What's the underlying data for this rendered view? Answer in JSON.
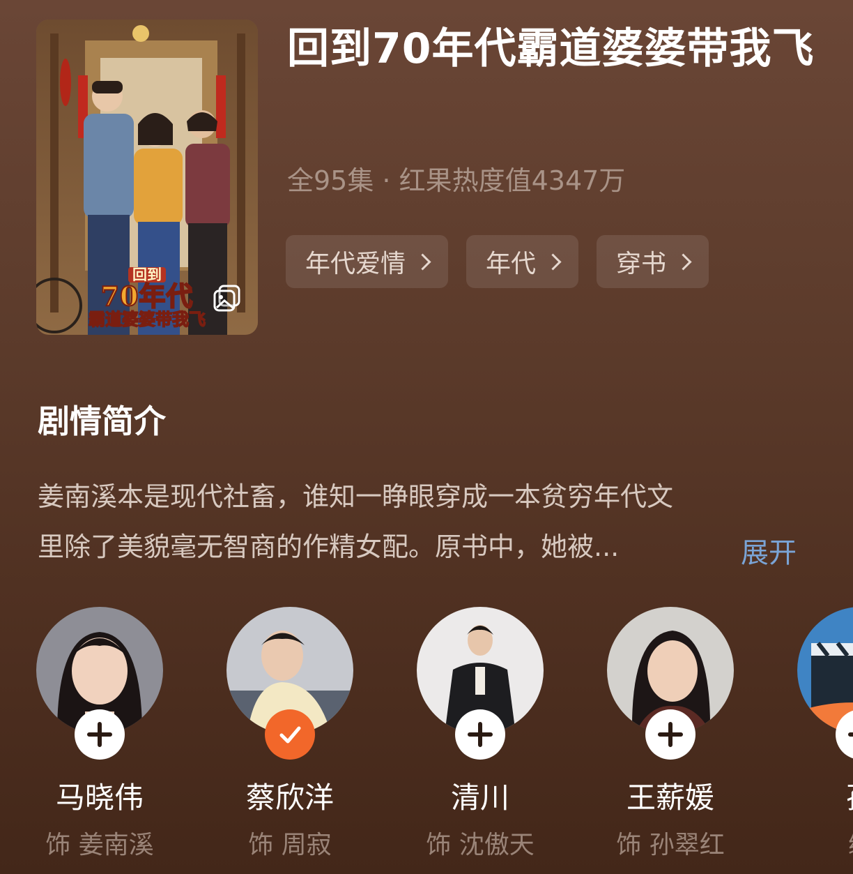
{
  "drama": {
    "title": "回到70年代霸道婆婆带我飞",
    "meta": "全95集 · 红果热度值4347万",
    "poster": {
      "line1": "回到",
      "line2": "70年代",
      "line3": "霸道婆婆带我飞",
      "gallery_icon": "gallery-icon"
    },
    "tags": [
      {
        "label": "年代爱情"
      },
      {
        "label": "年代"
      },
      {
        "label": "穿书"
      }
    ]
  },
  "synopsis": {
    "heading": "剧情简介",
    "line1": "姜南溪本是现代社畜，谁知一睁眼穿成一本贫穷年代文",
    "line2": "里除了美貌毫无智商的作精女配。原书中，她被...",
    "expand_label": "展开"
  },
  "cast": [
    {
      "name": "马晓伟",
      "role": "饰 姜南溪",
      "followed": false
    },
    {
      "name": "蔡欣洋",
      "role": "饰 周寂",
      "followed": true
    },
    {
      "name": "清川",
      "role": "饰 沈傲天",
      "followed": false
    },
    {
      "name": "王薪媛",
      "role": "饰 孙翠红",
      "followed": false
    },
    {
      "name": "孙",
      "role": "编",
      "followed": false
    }
  ],
  "colors": {
    "accent_follow": "#f2672a",
    "link": "#7aa4d6"
  }
}
